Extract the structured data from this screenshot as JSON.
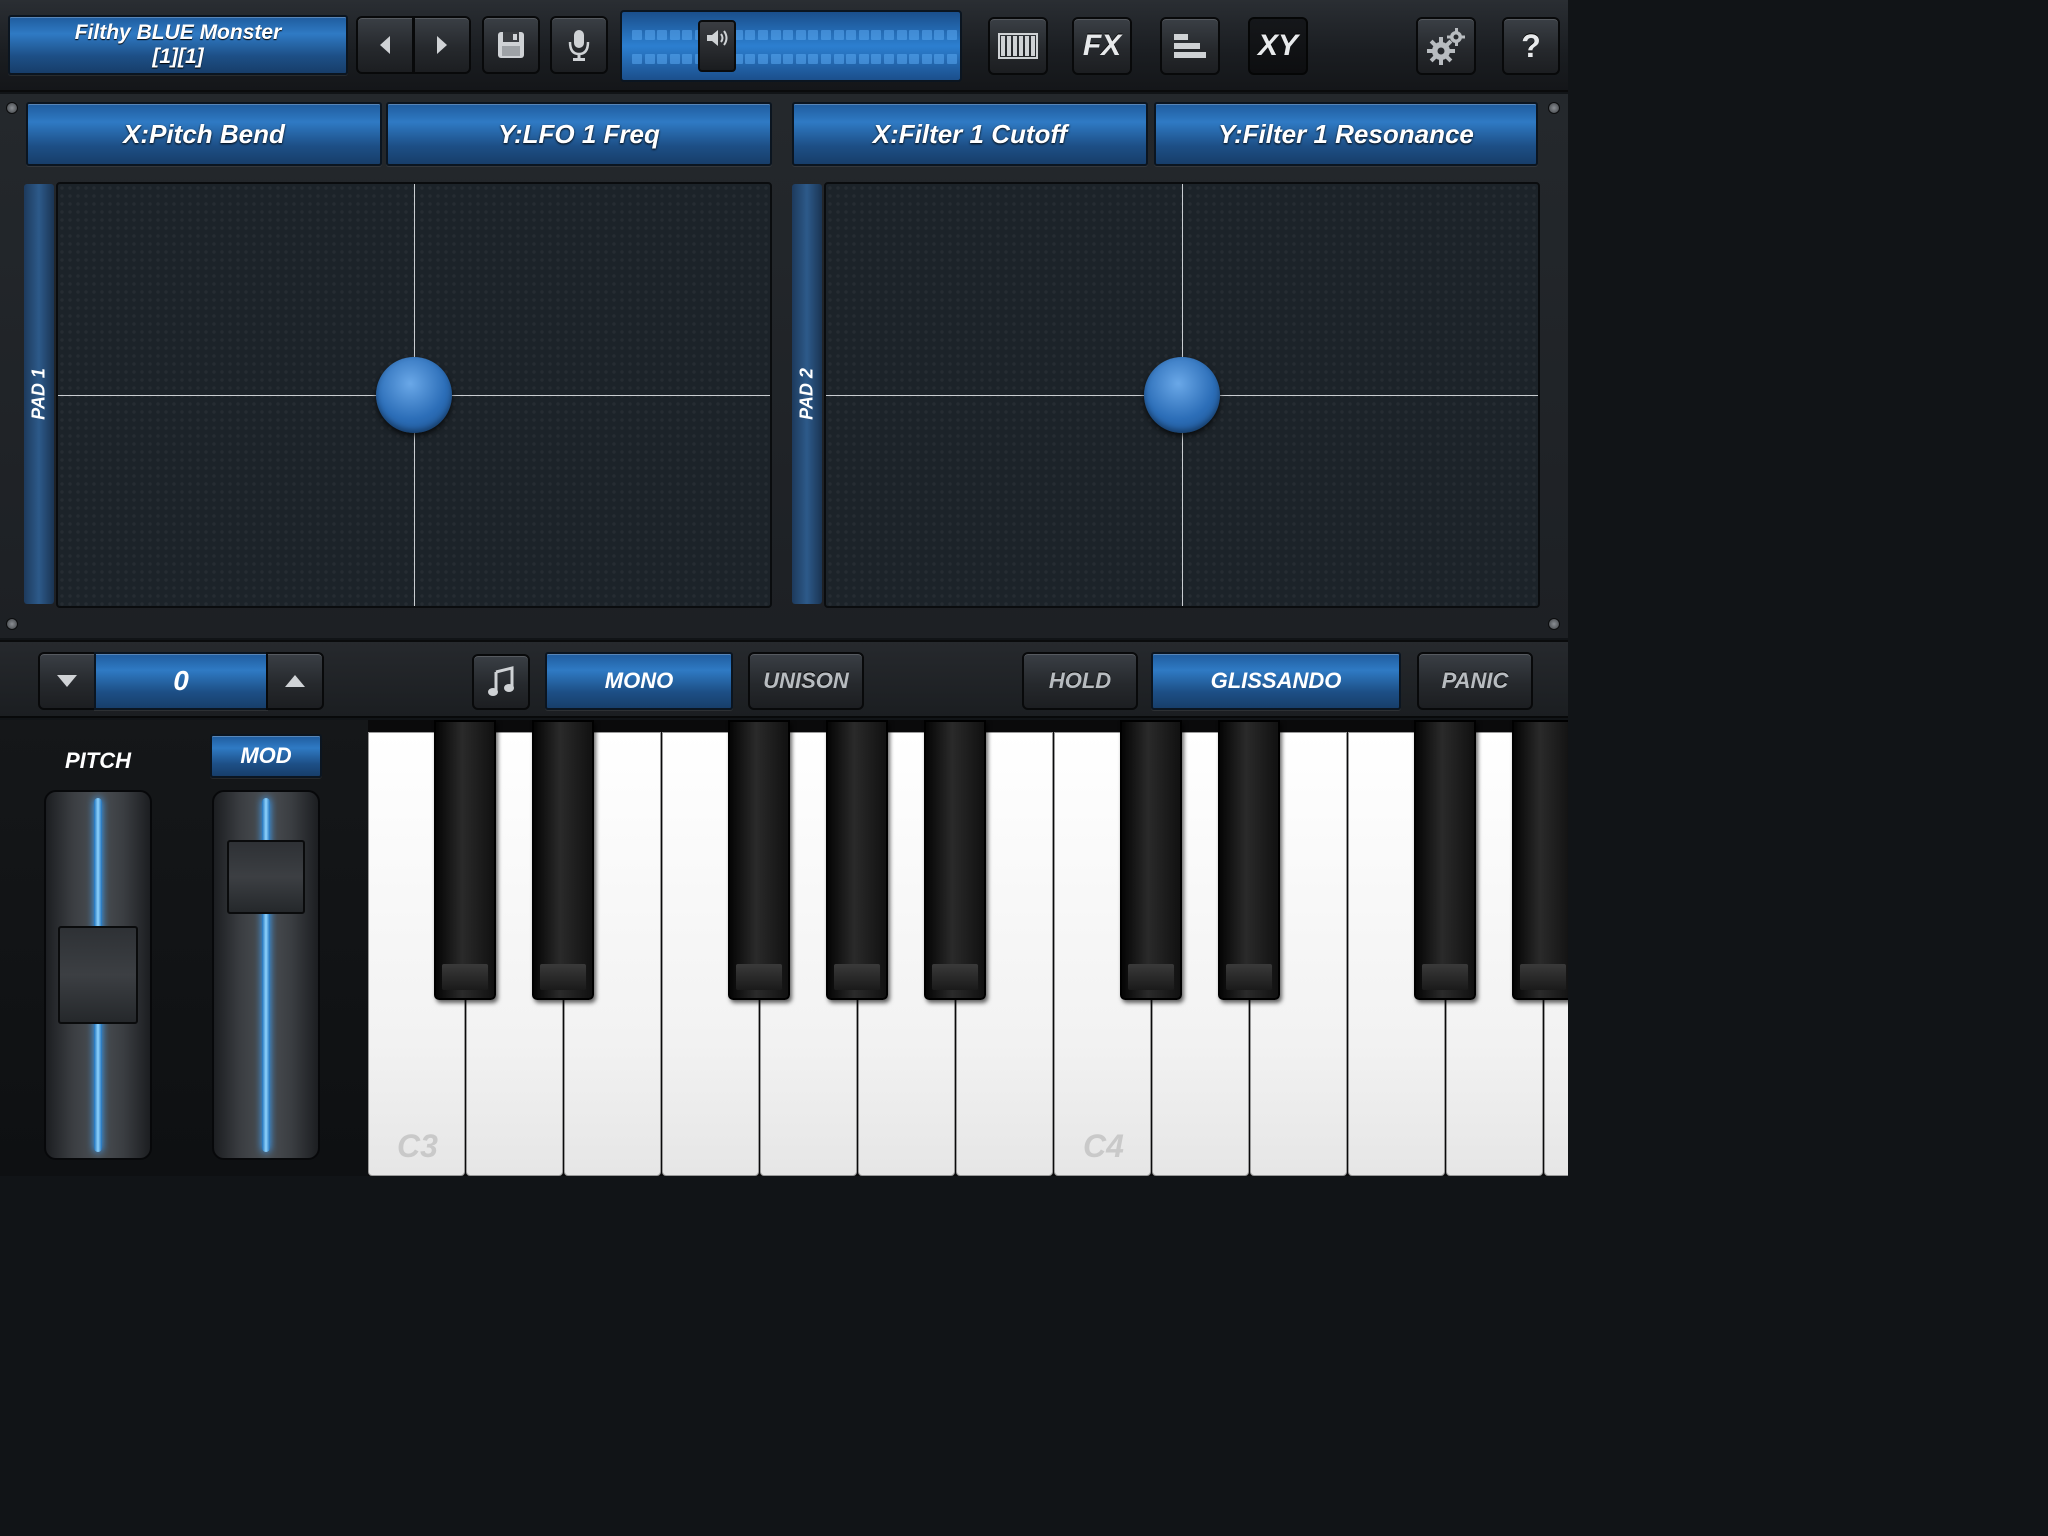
{
  "header": {
    "preset_line1": "Filthy BLUE Monster",
    "preset_line2": "[1][1]",
    "fx_label": "FX",
    "xy_label": "XY",
    "help_label": "?"
  },
  "xy": {
    "pad1": {
      "side_label": "PAD 1",
      "x_param": "X:Pitch Bend",
      "y_param": "Y:LFO 1 Freq",
      "x_value": 0.5,
      "y_value": 0.5
    },
    "pad2": {
      "side_label": "PAD 2",
      "x_param": "X:Filter 1 Cutoff",
      "y_param": "Y:Filter 1 Resonance",
      "x_value": 0.5,
      "y_value": 0.5
    }
  },
  "controls": {
    "octave_value": "0",
    "mono_label": "MONO",
    "unison_label": "UNISON",
    "hold_label": "HOLD",
    "glissando_label": "GLISSANDO",
    "panic_label": "PANIC"
  },
  "wheels": {
    "pitch_label": "PITCH",
    "mod_label": "MOD",
    "pitch_value": 0.5,
    "mod_value": 0.85
  },
  "keyboard": {
    "labels": [
      "C3",
      "C4"
    ]
  },
  "colors": {
    "accent_blue": "#2f7ac4",
    "glow_blue": "#8fd4ff"
  },
  "icons": [
    "chevron-left-icon",
    "chevron-right-icon",
    "save-icon",
    "microphone-icon",
    "speaker-icon",
    "keyboard-icon",
    "mixer-icon",
    "gear-icon",
    "music-note-icon",
    "triangle-down-icon",
    "triangle-up-icon"
  ]
}
